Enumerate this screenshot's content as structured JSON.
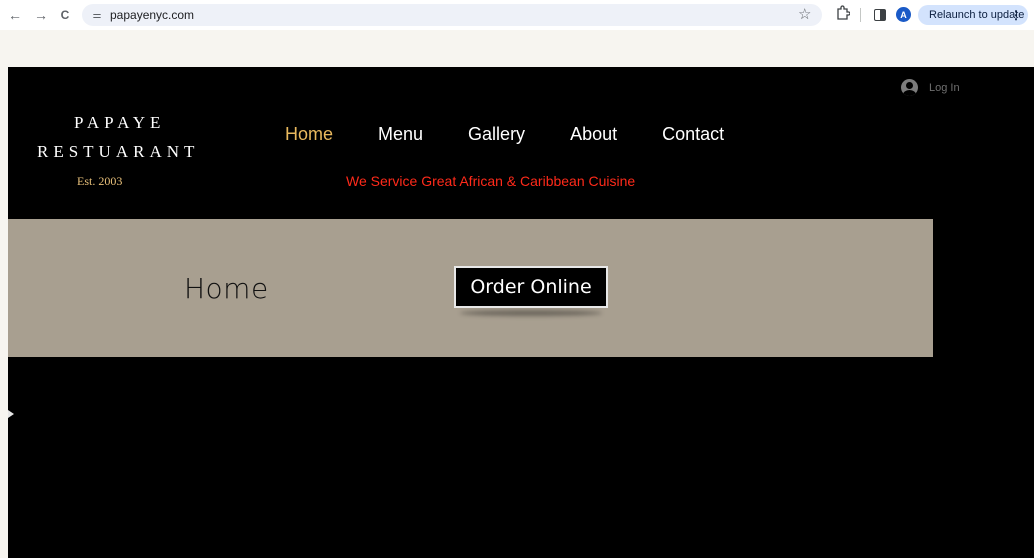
{
  "browser": {
    "url": "papayenyc.com",
    "back_glyph": "←",
    "forward_glyph": "→",
    "reload_glyph": "C",
    "site_info_glyph": "⚌",
    "star_glyph": "☆",
    "avatar_letter": "A",
    "relaunch_label": "Relaunch to update",
    "menu_glyph": "⋮"
  },
  "header": {
    "login_label": "Log In",
    "brand_line1": "PAPAYE",
    "brand_line2": "RESTUARANT",
    "brand_est": "Est. 2003",
    "nav": [
      {
        "label": "Home",
        "active": true
      },
      {
        "label": "Menu",
        "active": false
      },
      {
        "label": "Gallery",
        "active": false
      },
      {
        "label": "About",
        "active": false
      },
      {
        "label": "Contact",
        "active": false
      }
    ],
    "tagline": "We Service Great African & Caribbean Cuisine"
  },
  "hero": {
    "title": "Home",
    "order_button_label": "Order Online"
  },
  "colors": {
    "background": "#000000",
    "nav_active": "#e9b95e",
    "tagline": "#ff2a1a",
    "hero_band": "#a89f90",
    "page_strip": "#f7f5f0",
    "est_text": "#e8c07a"
  }
}
